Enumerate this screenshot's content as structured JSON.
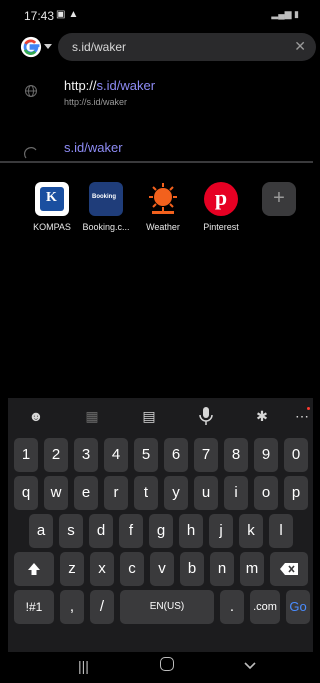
{
  "status_bar": {
    "time": "17:43"
  },
  "search": {
    "query": "s.id/waker"
  },
  "suggestions": [
    {
      "title_prefix": "http://",
      "title_highlight": "s.id/waker",
      "subtitle": "http://s.id/waker",
      "icon": "globe-icon"
    },
    {
      "title_highlight": "s.id/waker",
      "icon": "search-icon"
    }
  ],
  "shortcuts": [
    {
      "label": "KOMPAS",
      "icon": "kompas-logo-icon",
      "color": "#1a4fa0"
    },
    {
      "label": "Booking.c...",
      "icon": "booking-logo-icon",
      "color": "#1f3d7a"
    },
    {
      "label": "Weather",
      "icon": "accuweather-logo-icon",
      "color": "#f2611d"
    },
    {
      "label": "Pinterest",
      "icon": "pinterest-logo-icon",
      "color": "#e60023"
    },
    {
      "label": "",
      "icon": "add-icon",
      "color": "#3a3a3c"
    }
  ],
  "keyboard": {
    "toolbar": [
      "emoji-icon",
      "sticker-icon",
      "clipboard-icon",
      "mic-icon",
      "settings-icon",
      "more-icon"
    ],
    "rows": [
      [
        "1",
        "2",
        "3",
        "4",
        "5",
        "6",
        "7",
        "8",
        "9",
        "0"
      ],
      [
        "q",
        "w",
        "e",
        "r",
        "t",
        "y",
        "u",
        "i",
        "o",
        "p"
      ],
      [
        "a",
        "s",
        "d",
        "f",
        "g",
        "h",
        "j",
        "k",
        "l"
      ],
      [
        "z",
        "x",
        "c",
        "v",
        "b",
        "n",
        "m"
      ]
    ],
    "symbols_key": "!#1",
    "comma_key": ",",
    "slash_key": "/",
    "space_key": "EN(US)",
    "period_key": ".",
    "dotcom_key": ".com",
    "go_key": "Go",
    "accent_color": "#4a8cff"
  }
}
